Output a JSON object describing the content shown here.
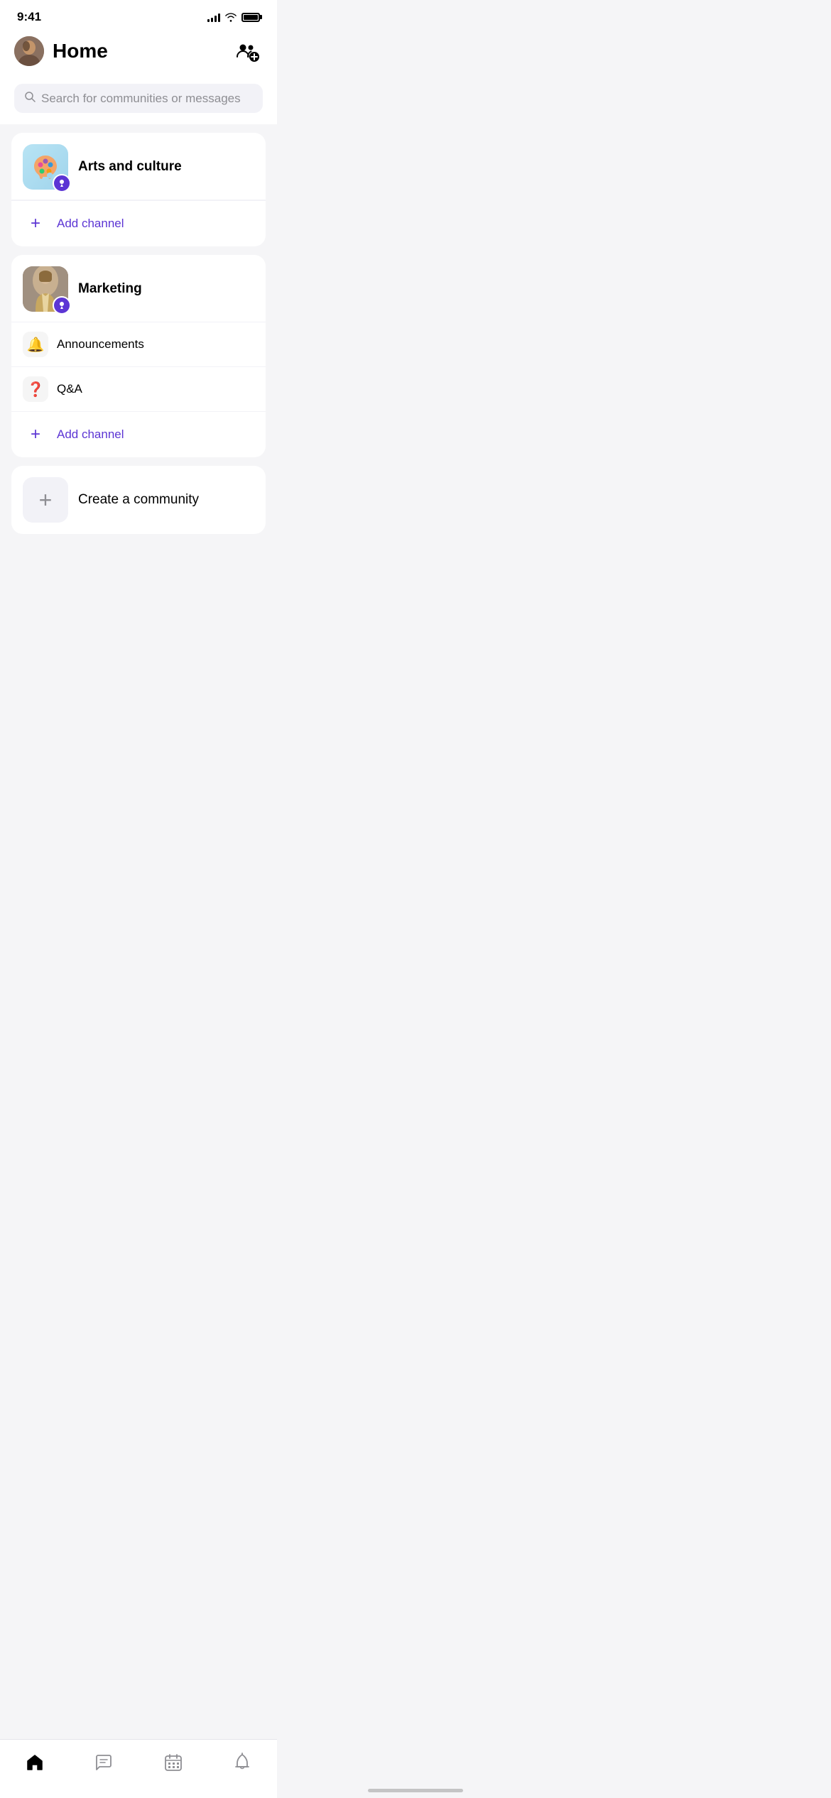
{
  "statusBar": {
    "time": "9:41",
    "signals": [
      4,
      6,
      8,
      10,
      12
    ],
    "wifi": "wifi",
    "battery": "battery"
  },
  "header": {
    "title": "Home",
    "addButtonLabel": "add community"
  },
  "search": {
    "placeholder": "Search for communities or messages"
  },
  "communities": [
    {
      "id": "arts",
      "name": "Arts and culture",
      "type": "arts",
      "channels": [],
      "hasBadge": true
    },
    {
      "id": "marketing",
      "name": "Marketing",
      "type": "marketing",
      "channels": [
        {
          "id": "announcements",
          "name": "Announcements",
          "emoji": "🔔"
        },
        {
          "id": "qanda",
          "name": "Q&A",
          "emoji": "❓"
        }
      ],
      "hasBadge": true
    }
  ],
  "addChannel": {
    "label": "Add channel",
    "plusSymbol": "+"
  },
  "createCommunity": {
    "label": "Create a community",
    "plusSymbol": "+"
  },
  "bottomNav": [
    {
      "id": "home",
      "label": "Home",
      "icon": "🏠",
      "active": true
    },
    {
      "id": "messages",
      "label": "Messages",
      "icon": "💬",
      "active": false
    },
    {
      "id": "calendar",
      "label": "Calendar",
      "icon": "📅",
      "active": false
    },
    {
      "id": "notifications",
      "label": "Notifications",
      "icon": "🔔",
      "active": false
    }
  ],
  "badge": {
    "symbol": "🏅"
  },
  "colors": {
    "accent": "#5c35d4",
    "background": "#f5f5f7",
    "cardBg": "#ffffff",
    "searchBg": "#f2f2f7",
    "inactive": "#8e8e93"
  }
}
